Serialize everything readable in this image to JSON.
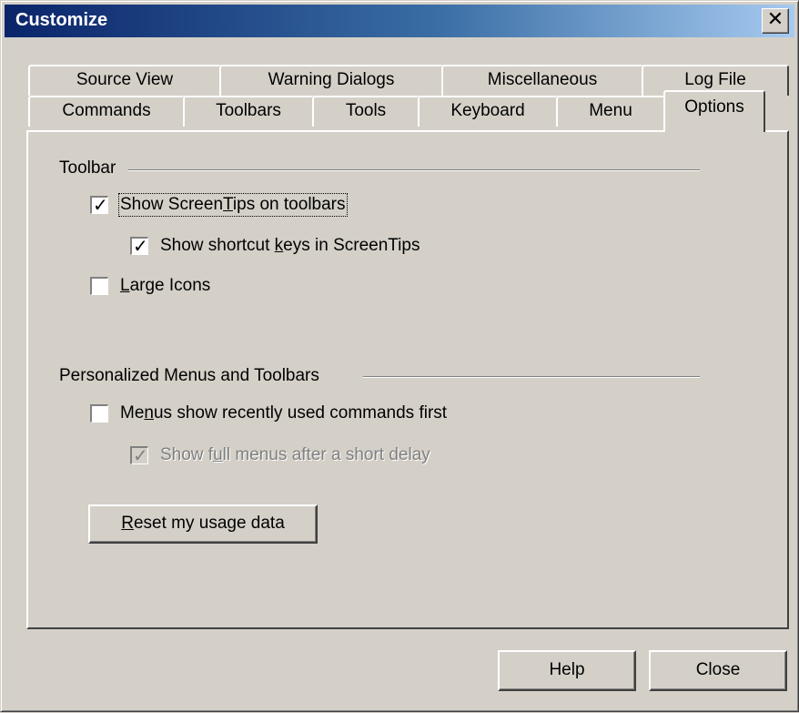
{
  "window": {
    "title": "Customize",
    "close_glyph": "✕"
  },
  "tabs": {
    "back": [
      "Source View",
      "Warning Dialogs",
      "Miscellaneous",
      "Log File"
    ],
    "front": [
      "Commands",
      "Toolbars",
      "Tools",
      "Keyboard",
      "Menu",
      "Options"
    ],
    "active": "Options"
  },
  "toolbar_group": {
    "label": "Toolbar",
    "show_screentips": {
      "pre": "Show Screen",
      "u": "T",
      "post": "ips on toolbars",
      "checked": true
    },
    "show_shortcut_keys": {
      "pre": "Show shortcut ",
      "u": "k",
      "post": "eys in ScreenTips",
      "checked": true
    },
    "large_icons": {
      "pre": "",
      "u": "L",
      "post": "arge Icons",
      "checked": false
    }
  },
  "personalized_group": {
    "label": "Personalized Menus and Toolbars",
    "menus_recent": {
      "pre": "Me",
      "u": "n",
      "post": "us show recently used commands first",
      "checked": false
    },
    "full_menus_delay": {
      "pre": "Show f",
      "u": "u",
      "post": "ll menus after a short delay",
      "checked": true,
      "disabled": true
    },
    "reset_button": {
      "pre": "",
      "u": "R",
      "post": "eset my usage data"
    }
  },
  "footer": {
    "help_label": "Help",
    "close_label": "Close"
  },
  "colors": {
    "face": "#d4d0c8",
    "title_start": "#0a246a",
    "title_end": "#a6caf0"
  }
}
